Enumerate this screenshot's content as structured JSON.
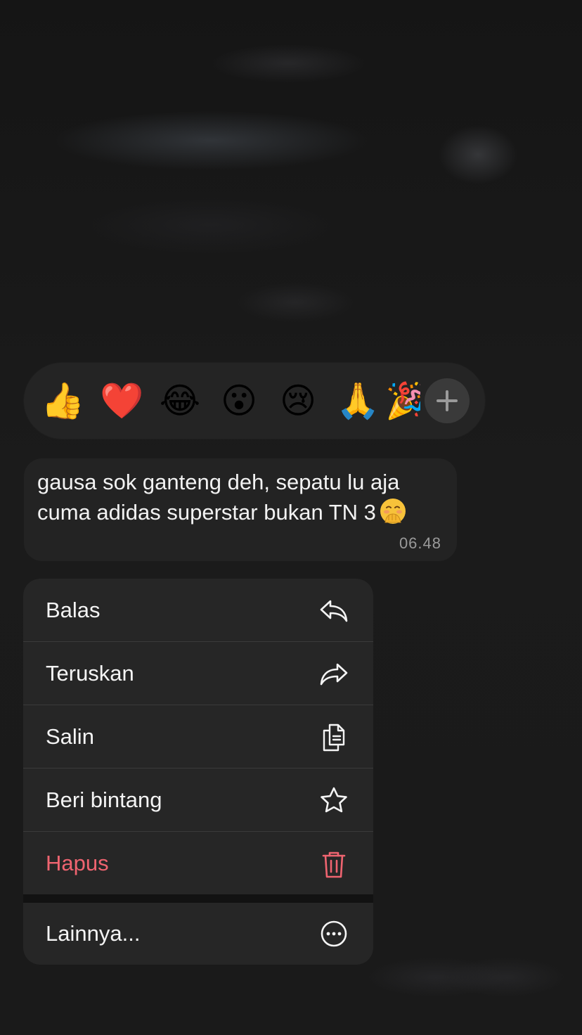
{
  "reactions": {
    "emojis": [
      "👍",
      "❤️",
      "😂",
      "😮",
      "😢",
      "🙏",
      "🎉"
    ],
    "more_button_icon": "plus-icon"
  },
  "message": {
    "text": "gausa sok ganteng deh, sepatu lu aja cuma adidas superstar bukan TN 3",
    "emoji": "🤭",
    "time": "06.48"
  },
  "menu": {
    "items": [
      {
        "label": "Balas",
        "icon": "reply-icon"
      },
      {
        "label": "Teruskan",
        "icon": "forward-icon"
      },
      {
        "label": "Salin",
        "icon": "copy-icon"
      },
      {
        "label": "Beri bintang",
        "icon": "star-icon"
      },
      {
        "label": "Hapus",
        "icon": "trash-icon",
        "color": "#ef6470"
      },
      {
        "label": "Lainnya...",
        "icon": "more-icon"
      }
    ]
  }
}
